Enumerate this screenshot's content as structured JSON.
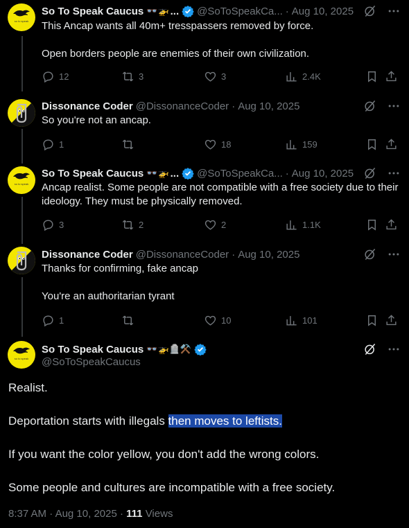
{
  "tweets": [
    {
      "name": "So To Speak Caucus",
      "name_suffix": "...",
      "handle": "@SoToSpeakCa...",
      "date": "Aug 10, 2025",
      "paragraphs": [
        "This Ancap wants all 40m+ tresspassers removed by force.",
        "Open borders people are enemies of their own civilization."
      ],
      "replies": "12",
      "reposts": "3",
      "likes": "3",
      "views": "2.4K"
    },
    {
      "name": "Dissonance Coder",
      "handle": "@DissonanceCoder",
      "date": "Aug 10, 2025",
      "paragraphs": [
        "So you're not an ancap."
      ],
      "replies": "1",
      "reposts": "",
      "likes": "18",
      "views": "159"
    },
    {
      "name": "So To Speak Caucus",
      "name_suffix": "...",
      "handle": "@SoToSpeakCa...",
      "date": "Aug 10, 2025",
      "paragraphs": [
        "Ancap realist. Some people are not compatible with a free society due to their ideology. They must be physically removed."
      ],
      "replies": "3",
      "reposts": "2",
      "likes": "2",
      "views": "1.1K"
    },
    {
      "name": "Dissonance Coder",
      "handle": "@DissonanceCoder",
      "date": "Aug 10, 2025",
      "paragraphs": [
        "Thanks for confirming, fake ancap",
        "You're an authoritarian tyrant"
      ],
      "replies": "1",
      "reposts": "",
      "likes": "10",
      "views": "101"
    }
  ],
  "main": {
    "name": "So To Speak Caucus",
    "handle": "@SoToSpeakCaucus",
    "p1": "Realist.",
    "p2_before": "Deportation starts with illegals ",
    "p2_highlight": "then moves to leftists.",
    "p3": "If you want the color yellow, you don't add the wrong colors.",
    "p4": "Some people and cultures are incompatible with a free society.",
    "time": "8:37 AM",
    "date": "Aug 10, 2025",
    "views_count": "111",
    "views_label": "Views",
    "separator": "·"
  },
  "colors": {
    "accent": "#1d9bf0",
    "highlight": "#1d4aa8",
    "muted": "#71767b",
    "avatar_yellow": "#f3e600"
  },
  "icons": [
    "reply-icon",
    "repost-icon",
    "like-icon",
    "views-icon",
    "bookmark-icon",
    "share-icon",
    "grok-icon",
    "more-icon",
    "verified-icon"
  ]
}
